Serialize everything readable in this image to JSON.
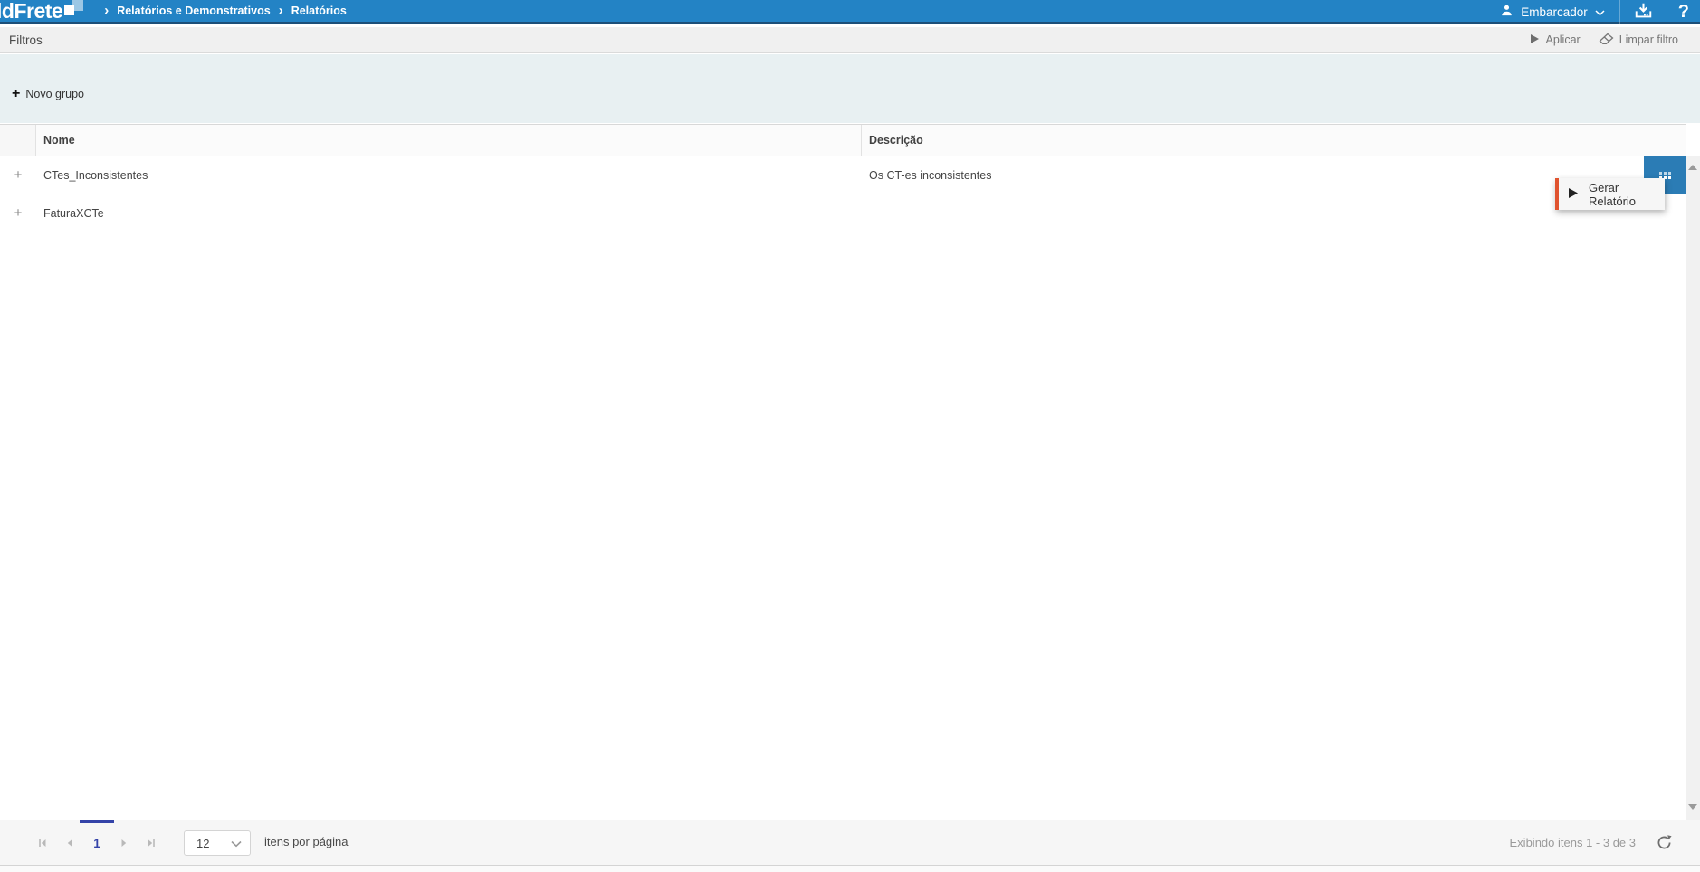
{
  "icons": {
    "plus": "+",
    "breadcrumb_separator": "›",
    "help": "?"
  },
  "colors": {
    "header_blue": "#2383c5",
    "header_border_navy": "#1c4f78",
    "panel_light_blue": "#e8f0f2",
    "row_action_blue": "#2b7cb5",
    "context_menu_accent_orange": "#e0532f",
    "pager_active_blue": "#3443a8"
  },
  "header": {
    "logo_text": "ldFrete",
    "breadcrumb": [
      "Relatórios e Demonstrativos",
      "Relatórios"
    ],
    "user_label": "Embarcador"
  },
  "filters_bar": {
    "title": "Filtros",
    "apply_label": "Aplicar",
    "clear_label": "Limpar filtro"
  },
  "groups_panel": {
    "new_group_label": "Novo grupo"
  },
  "table": {
    "columns": [
      "Nome",
      "Descrição"
    ],
    "rows": [
      {
        "name": "CTes_Inconsistentes",
        "description": "Os CT-es inconsistentes"
      },
      {
        "name": "FaturaXCTe",
        "description": ""
      }
    ]
  },
  "context_menu": {
    "items": [
      {
        "label": "Gerar Relatório"
      }
    ]
  },
  "pagination": {
    "current_page": "1",
    "page_size": "12",
    "page_size_label": "itens por página",
    "status_text": "Exibindo itens 1 - 3 de 3"
  }
}
